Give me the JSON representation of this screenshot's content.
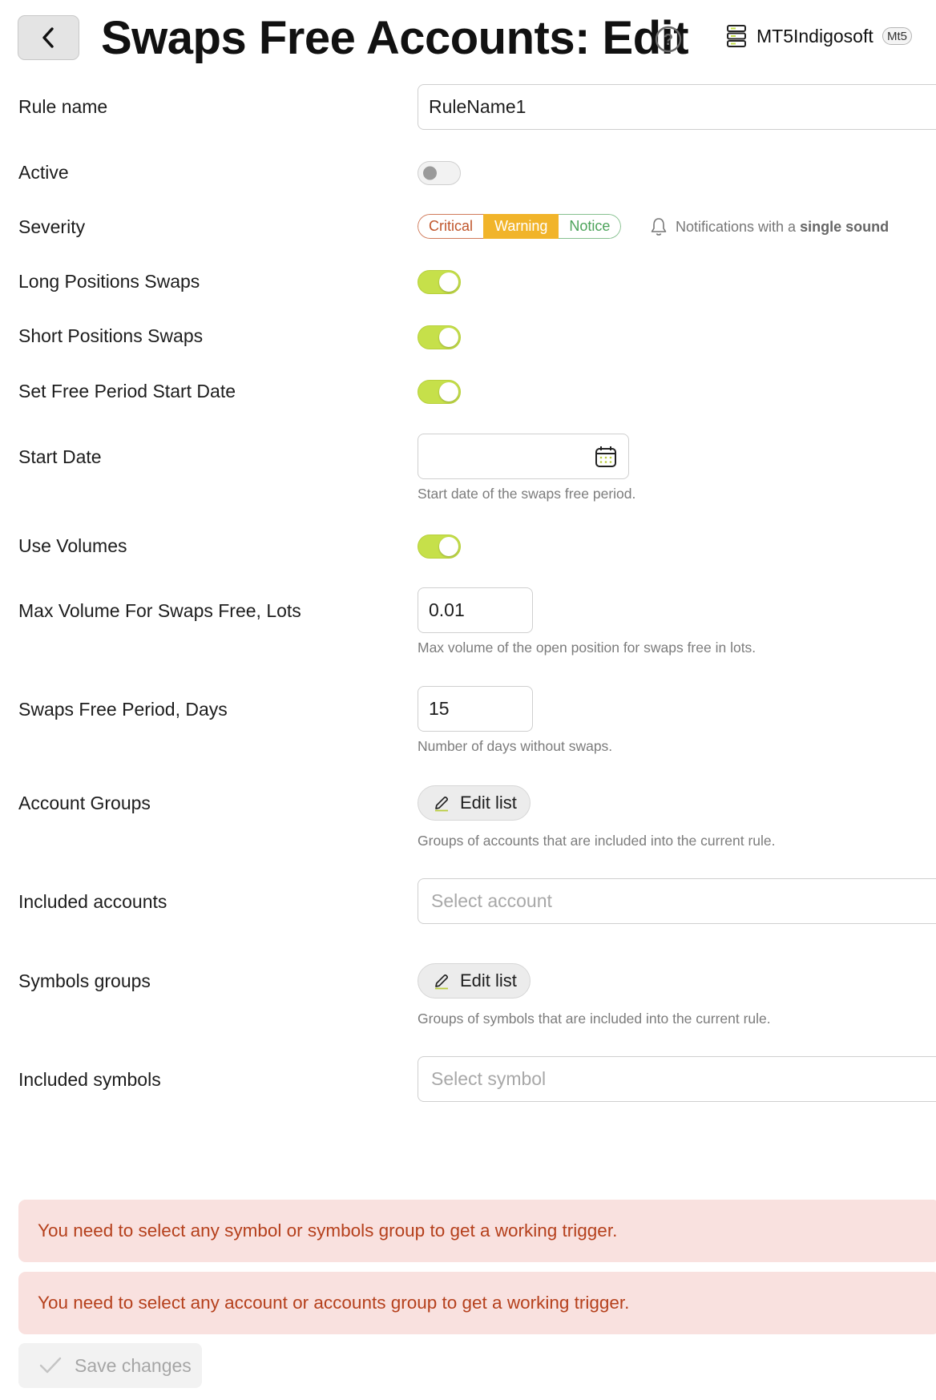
{
  "header": {
    "title": "Swaps Free Accounts: Edit",
    "server_name": "MT5Indigosoft",
    "server_badge": "Mt5"
  },
  "icons": {
    "back": "chevron-left-icon",
    "help": "question-circle-icon",
    "server": "server-icon",
    "bell": "bell-icon",
    "calendar": "calendar-icon",
    "pencil": "pencil-icon",
    "check": "check-icon"
  },
  "form": {
    "rule_name": {
      "label": "Rule name",
      "value": "RuleName1"
    },
    "active": {
      "label": "Active",
      "on": false
    },
    "severity": {
      "label": "Severity",
      "options": [
        "Critical",
        "Warning",
        "Notice"
      ],
      "selected": "Warning",
      "note_prefix": "Notifications with a",
      "note_bold": "single sound"
    },
    "long_swaps": {
      "label": "Long Positions Swaps",
      "on": true
    },
    "short_swaps": {
      "label": "Short Positions Swaps",
      "on": true
    },
    "set_start_date": {
      "label": "Set Free Period Start Date",
      "on": true
    },
    "start_date": {
      "label": "Start Date",
      "value": "",
      "hint": "Start date of the swaps free period."
    },
    "use_volumes": {
      "label": "Use Volumes",
      "on": true
    },
    "max_volume": {
      "label": "Max Volume For Swaps Free, Lots",
      "value": "0.01",
      "hint": "Max volume of the open position for swaps free in lots."
    },
    "free_period": {
      "label": "Swaps Free Period, Days",
      "value": "15",
      "hint": "Number of days without swaps."
    },
    "account_groups": {
      "label": "Account Groups",
      "button": "Edit list",
      "hint": "Groups of accounts that are included into the current rule."
    },
    "included_accounts": {
      "label": "Included accounts",
      "placeholder": "Select account"
    },
    "symbol_groups": {
      "label": "Symbols groups",
      "button": "Edit list",
      "hint": "Groups of symbols that are included into the current rule."
    },
    "included_symbols": {
      "label": "Included symbols",
      "placeholder": "Select symbol"
    }
  },
  "alerts": [
    "You need to select any symbol or symbols group to get a working trigger.",
    "You need to select any account or accounts group to get a working trigger."
  ],
  "colors": {
    "toggle_on": "#c6e04a",
    "warning": "#f1b42a",
    "critical": "#c0562c",
    "notice": "#4ca35a",
    "alert_bg": "#f9e1df",
    "alert_text": "#b5401c"
  },
  "save_button": "Save changes"
}
